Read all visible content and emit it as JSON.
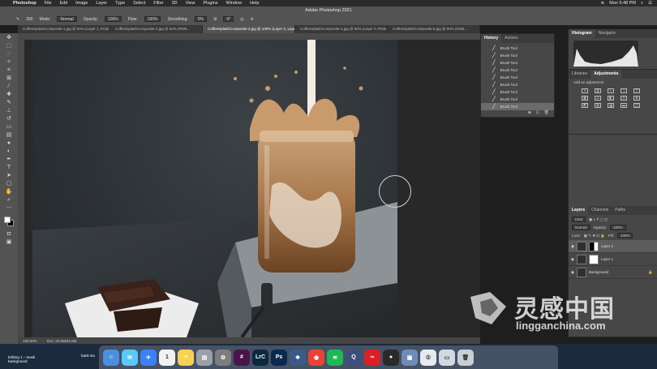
{
  "menubar": {
    "app_name": "Photoshop",
    "items": [
      "File",
      "Edit",
      "Image",
      "Layer",
      "Type",
      "Select",
      "Filter",
      "3D",
      "View",
      "Plugins",
      "Window",
      "Help"
    ],
    "clock": "Mon 5:48 PM"
  },
  "window_title": "Adobe Photoshop 2021",
  "options": {
    "brush_size": "300",
    "mode_label": "Mode:",
    "mode_value": "Normal",
    "opacity_label": "Opacity:",
    "opacity_value": "100%",
    "flow_label": "Flow:",
    "flow_value": "100%",
    "smoothing_label": "Smoothing:",
    "smoothing_value": "0%",
    "angle_value": "0°"
  },
  "tabs": [
    {
      "label": "CoffeeSplashComposite-1.jpg @ 50% (Layer 1, RGB...",
      "active": false
    },
    {
      "label": "CoffeeSplashComposite-2.jpg @ 50% (RGB...",
      "active": false
    },
    {
      "label": "CoffeeSplashComposite-3.jpg @ 100% (Layer 2, Layer Mask/8) *",
      "active": true
    },
    {
      "label": "CoffeeSplashComposite-4.jpg @ 50% (Layer 0, RGB...",
      "active": false
    },
    {
      "label": "CoffeeSplashComposite-5.jpg @ 50% (RGB...",
      "active": false
    }
  ],
  "history": {
    "tabs": [
      "History",
      "Actions"
    ],
    "items": [
      "Brush Tool",
      "Brush Tool",
      "Brush Tool",
      "Brush Tool",
      "Brush Tool",
      "Brush Tool",
      "Brush Tool",
      "Brush Tool",
      "Brush Tool"
    ],
    "selected_index": 8
  },
  "histogram_panel": {
    "tabs": [
      "Histogram",
      "Navigator"
    ]
  },
  "adjustments_panel": {
    "tabs": [
      "Libraries",
      "Adjustments"
    ],
    "title": "Add an adjustment"
  },
  "layers_panel": {
    "tabs": [
      "Layers",
      "Channels",
      "Paths"
    ],
    "filter_label": "Kind",
    "blend_mode": "Normal",
    "opacity_label": "Opacity:",
    "opacity_value": "100%",
    "lock_label": "Lock:",
    "fill_label": "Fill:",
    "fill_value": "100%",
    "layers": [
      {
        "name": "Layer 2",
        "selected": true,
        "mask": true
      },
      {
        "name": "Layer 1",
        "selected": false,
        "mask": true
      },
      {
        "name": "Background",
        "selected": false,
        "mask": false
      }
    ]
  },
  "status": {
    "zoom": "100.00%",
    "doc_size": "Doc: 23.5M/46.6M"
  },
  "desktop": {
    "left_label": "Editing 1 – mask background",
    "right_label": "bank stu"
  },
  "dock": {
    "icons": [
      {
        "name": "finder-icon",
        "glyph": "☺",
        "color": "#4a90e2"
      },
      {
        "name": "messages-icon",
        "glyph": "✉",
        "color": "#5ac8fa"
      },
      {
        "name": "mail-icon",
        "glyph": "✈",
        "color": "#3b82f6"
      },
      {
        "name": "calendar-icon",
        "glyph": "1",
        "color": "#f2f2f2"
      },
      {
        "name": "notes-icon",
        "glyph": "≡",
        "color": "#f7d154"
      },
      {
        "name": "preview-icon",
        "glyph": "▤",
        "color": "#9aa0a6"
      },
      {
        "name": "system-preferences-icon",
        "glyph": "⚙",
        "color": "#7d7d7d"
      },
      {
        "name": "slack-icon",
        "glyph": "#",
        "color": "#4a154b"
      },
      {
        "name": "lightroom-classic-icon",
        "glyph": "LrC",
        "color": "#0b2a3f"
      },
      {
        "name": "photoshop-icon",
        "glyph": "Ps",
        "color": "#0a2a4d"
      },
      {
        "name": "fan-app-icon",
        "glyph": "❖",
        "color": "#3a5a88"
      },
      {
        "name": "chrome-icon",
        "glyph": "◉",
        "color": "#e94335"
      },
      {
        "name": "spotify-icon",
        "glyph": "≋",
        "color": "#1db954"
      },
      {
        "name": "qreate-icon",
        "glyph": "Q",
        "color": "#3c4f7a"
      },
      {
        "name": "creative-cloud-icon",
        "glyph": "∞",
        "color": "#da1f26"
      },
      {
        "name": "obs-icon",
        "glyph": "●",
        "color": "#2a2a2a"
      },
      {
        "name": "photos-app-icon",
        "glyph": "▣",
        "color": "#6e8db5"
      },
      {
        "name": "1password-icon",
        "glyph": "①",
        "color": "#e6e9ee"
      },
      {
        "name": "screen-icon",
        "glyph": "▭",
        "color": "#cfd8e3"
      },
      {
        "name": "trash-icon",
        "glyph": "🗑",
        "color": "#c9ced6"
      }
    ]
  },
  "watermark": {
    "cn": "灵感中国",
    "url": "lingganchina.com"
  }
}
